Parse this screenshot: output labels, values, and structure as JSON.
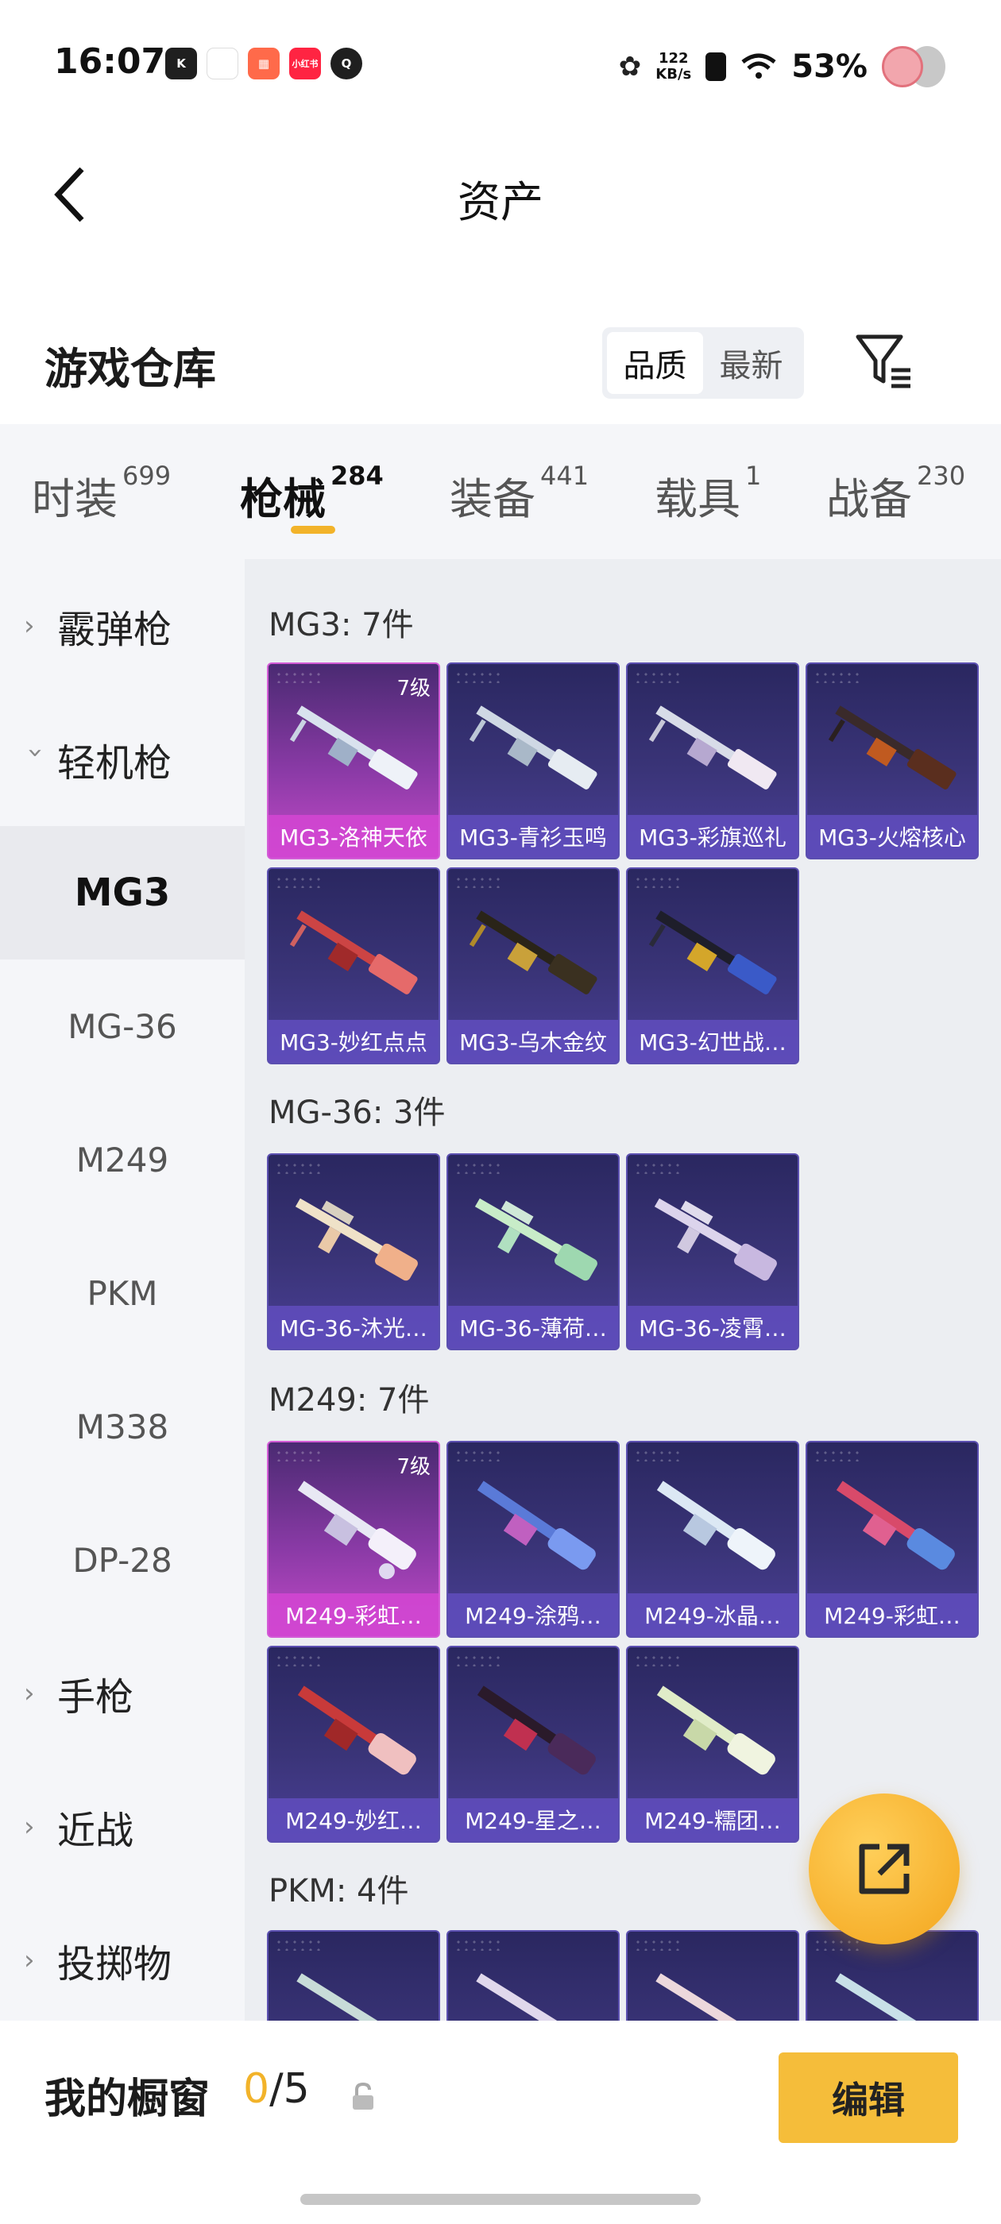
{
  "status_bar": {
    "time": "16:07",
    "speed_top": "122",
    "speed_bottom": "KB/s",
    "battery": "53%",
    "app_icons": [
      {
        "name": "kuaishou-icon",
        "label": "K",
        "color": "#222222"
      },
      {
        "name": "calendar-icon",
        "label": "",
        "color": "#ffffff"
      },
      {
        "name": "app-grid-icon",
        "label": "",
        "color": "#ff5a5f"
      },
      {
        "name": "xiaohongshu-icon",
        "label": "小红书",
        "color": "#ff2442"
      },
      {
        "name": "q-app-icon",
        "label": "Q",
        "color": "#222222"
      }
    ]
  },
  "header": {
    "title": "资产"
  },
  "warehouse": {
    "title": "游戏仓库",
    "sort_options": [
      "品质",
      "最新"
    ],
    "sort_selected": "品质"
  },
  "tabs": [
    {
      "label": "时装",
      "count": "699"
    },
    {
      "label": "枪械",
      "count": "284"
    },
    {
      "label": "装备",
      "count": "441"
    },
    {
      "label": "载具",
      "count": "1"
    },
    {
      "label": "战备",
      "count": "230"
    }
  ],
  "active_tab": "枪械",
  "sidebar": {
    "shotgun": "霰弹枪",
    "lmg": "轻机枪",
    "lmg_items": [
      "MG3",
      "MG-36",
      "M249",
      "PKM",
      "M338",
      "DP-28"
    ],
    "pistol": "手枪",
    "melee": "近战",
    "throwable": "投掷物"
  },
  "groups": [
    {
      "title": "MG3: 7件",
      "items": [
        {
          "name": "MG3-洛神天依",
          "level": "7级",
          "rarity": "legendary"
        },
        {
          "name": "MG3-青衫玉鸣",
          "level": "",
          "rarity": "epic"
        },
        {
          "name": "MG3-彩旗巡礼",
          "level": "",
          "rarity": "epic"
        },
        {
          "name": "MG3-火熔核心",
          "level": "",
          "rarity": "epic"
        },
        {
          "name": "MG3-妙红点点",
          "level": "",
          "rarity": "epic"
        },
        {
          "name": "MG3-乌木金纹",
          "level": "",
          "rarity": "epic"
        },
        {
          "name": "MG3-幻世战…",
          "level": "",
          "rarity": "epic"
        }
      ]
    },
    {
      "title": "MG-36: 3件",
      "items": [
        {
          "name": "MG-36-沐光…",
          "level": "",
          "rarity": "epic"
        },
        {
          "name": "MG-36-薄荷…",
          "level": "",
          "rarity": "epic"
        },
        {
          "name": "MG-36-凌霄…",
          "level": "",
          "rarity": "epic"
        }
      ]
    },
    {
      "title": "M249: 7件",
      "items": [
        {
          "name": "M249-彩虹…",
          "level": "7级",
          "rarity": "legendary"
        },
        {
          "name": "M249-涂鸦…",
          "level": "",
          "rarity": "epic"
        },
        {
          "name": "M249-冰晶…",
          "level": "",
          "rarity": "epic"
        },
        {
          "name": "M249-彩虹…",
          "level": "",
          "rarity": "epic"
        },
        {
          "name": "M249-妙红…",
          "level": "",
          "rarity": "epic"
        },
        {
          "name": "M249-星之…",
          "level": "",
          "rarity": "epic"
        },
        {
          "name": "M249-糯团…",
          "level": "",
          "rarity": "epic"
        }
      ]
    },
    {
      "title": "PKM: 4件",
      "items": [
        {
          "name": "",
          "level": "",
          "rarity": "epic"
        },
        {
          "name": "",
          "level": "",
          "rarity": "epic"
        },
        {
          "name": "",
          "level": "",
          "rarity": "epic"
        },
        {
          "name": "",
          "level": "",
          "rarity": "epic"
        }
      ]
    }
  ],
  "showcase": {
    "label": "我的橱窗",
    "current": "0",
    "total": "/5",
    "edit_label": "编辑"
  },
  "colors": {
    "accent": "#f2b32a",
    "edit_button": "#f5bd3a",
    "card_epic": "#3a3478",
    "card_legendary": "#c24ac7"
  },
  "icons": {
    "back": "chevron-left-icon",
    "filter": "filter-icon",
    "share": "share-external-icon",
    "lock": "lock-icon"
  }
}
